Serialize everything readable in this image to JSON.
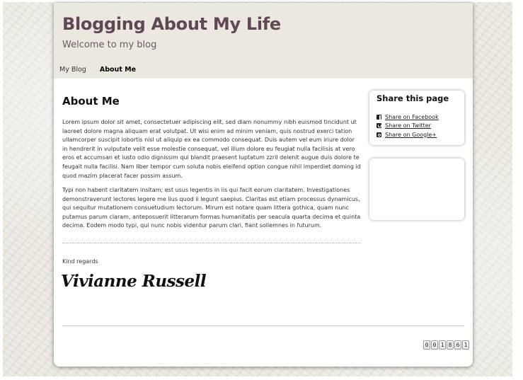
{
  "header": {
    "site_title": "Blogging About My Life",
    "tagline": "Welcome to my blog"
  },
  "nav": {
    "items": [
      {
        "label": "My Blog",
        "active": false
      },
      {
        "label": "About Me",
        "active": true
      }
    ]
  },
  "main": {
    "heading": "About Me",
    "paragraphs": [
      "Lorem ipsum dolor sit amet, consectetuer adipiscing elit, sed diam nonummy nibh euismod tincidunt ut laoreet dolore magna aliquam erat volutpat. Ut wisi enim ad minim veniam, quis nostrud exerci tation ullamcorper suscipit lobortis nisl ut aliquip ex ea commodo consequat. Duis autem vel eum iriure dolor in hendrerit in vulputate velit esse molestie consequat, vel illum dolore eu feugiat nulla facilisis at vero eros et accumsan et iusto odio dignissim qui blandit praesent luptatum zzril delenit augue duis dolore te feugait nulla facilisi. Nam liber tempor cum soluta nobis eleifend option congue nihil imperdiet doming id quod mazim placerat facer possim assum.",
      "Typi non habent claritatem insitam; est usus legentis in iis qui facit eorum claritatem. Investigationes demonstraverunt lectores legere me lius quod ii legunt saepius. Claritas est etiam processus dynamicus, qui sequitur mutationem consuetudium lectorum. Mirum est notare quam littera gothica, quam nunc putamus parum claram, anteposuerit litterarum formas humanitatis per seacula quarta decima et quinta decima. Eodem modo typi, qui nunc nobis videntur parum clari, fiant sollemnes in futurum."
    ],
    "regards": "Kind regards",
    "signature": "Vivianne Russell"
  },
  "sidebar": {
    "share_title": "Share this page",
    "share_links": [
      {
        "label": "Share on Facebook",
        "icon": "facebook-icon"
      },
      {
        "label": "Share on Twitter",
        "icon": "twitter-icon"
      },
      {
        "label": "Share on Google+",
        "icon": "google-plus-icon"
      }
    ]
  },
  "footer": {
    "counter_digits": [
      "0",
      "0",
      "1",
      "8",
      "6",
      "1"
    ]
  },
  "colors": {
    "title": "#5e4855",
    "header_bg": "#ebe8e0"
  }
}
